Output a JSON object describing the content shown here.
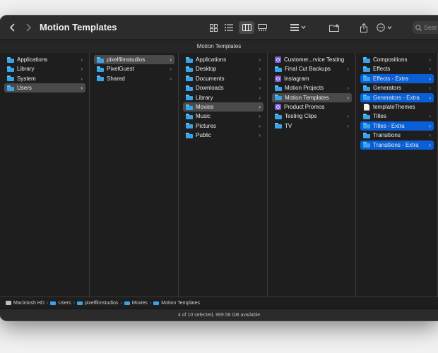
{
  "window": {
    "title": "Motion Templates",
    "tab_title": "Motion Templates",
    "search_placeholder": "Sear"
  },
  "toolbar_icons": [
    "chevron-left-icon",
    "chevron-right-icon",
    "icon-view-icon",
    "list-view-icon",
    "column-view-icon",
    "gallery-view-icon",
    "group-icon",
    "new-folder-icon",
    "share-icon",
    "more-icon",
    "search-icon"
  ],
  "columns": [
    {
      "items": [
        {
          "label": "Applications",
          "icon": "folder",
          "chevron": true,
          "state": ""
        },
        {
          "label": "Library",
          "icon": "folder",
          "chevron": true,
          "state": ""
        },
        {
          "label": "System",
          "icon": "folder",
          "chevron": true,
          "state": ""
        },
        {
          "label": "Users",
          "icon": "folder",
          "chevron": true,
          "state": "gray"
        }
      ]
    },
    {
      "items": [
        {
          "label": "pixelfilmstudios",
          "icon": "folder",
          "chevron": true,
          "state": "gray"
        },
        {
          "label": "PixelGuest",
          "icon": "folder",
          "chevron": true,
          "state": ""
        },
        {
          "label": "Shared",
          "icon": "folder",
          "chevron": true,
          "state": ""
        }
      ]
    },
    {
      "items": [
        {
          "label": "Applications",
          "icon": "folder",
          "chevron": true,
          "state": ""
        },
        {
          "label": "Desktop",
          "icon": "folder",
          "chevron": true,
          "state": ""
        },
        {
          "label": "Documents",
          "icon": "folder",
          "chevron": true,
          "state": ""
        },
        {
          "label": "Downloads",
          "icon": "folder",
          "chevron": true,
          "state": ""
        },
        {
          "label": "Library",
          "icon": "folder",
          "chevron": true,
          "state": ""
        },
        {
          "label": "Movies",
          "icon": "folder",
          "chevron": true,
          "state": "gray"
        },
        {
          "label": "Music",
          "icon": "folder",
          "chevron": true,
          "state": ""
        },
        {
          "label": "Pictures",
          "icon": "folder",
          "chevron": true,
          "state": ""
        },
        {
          "label": "Public",
          "icon": "folder",
          "chevron": true,
          "state": ""
        }
      ]
    },
    {
      "items": [
        {
          "label": "Customer...rvice Testing",
          "icon": "motion",
          "chevron": false,
          "state": ""
        },
        {
          "label": "Final Cut Backups",
          "icon": "folder",
          "chevron": true,
          "state": ""
        },
        {
          "label": "Instagram",
          "icon": "motion",
          "chevron": false,
          "state": ""
        },
        {
          "label": "Motion Projects",
          "icon": "folder",
          "chevron": true,
          "state": ""
        },
        {
          "label": "Motion Templates",
          "icon": "folder",
          "chevron": true,
          "state": "gray"
        },
        {
          "label": "Product Promos",
          "icon": "motion",
          "chevron": false,
          "state": ""
        },
        {
          "label": "Testing Clips",
          "icon": "folder",
          "chevron": true,
          "state": ""
        },
        {
          "label": "TV",
          "icon": "folder",
          "chevron": true,
          "state": ""
        }
      ]
    },
    {
      "items": [
        {
          "label": "Compositions",
          "icon": "folder",
          "chevron": true,
          "state": ""
        },
        {
          "label": "Effects",
          "icon": "folder",
          "chevron": true,
          "state": ""
        },
        {
          "label": "Effects - Extra",
          "icon": "folder",
          "chevron": true,
          "state": "blue"
        },
        {
          "label": "Generators",
          "icon": "folder",
          "chevron": true,
          "state": ""
        },
        {
          "label": "Generators - Extra",
          "icon": "folder",
          "chevron": true,
          "state": "blue"
        },
        {
          "label": "templateThemes",
          "icon": "doc",
          "chevron": false,
          "state": ""
        },
        {
          "label": "Titles",
          "icon": "folder",
          "chevron": true,
          "state": ""
        },
        {
          "label": "Titles - Extra",
          "icon": "folder",
          "chevron": true,
          "state": "blue"
        },
        {
          "label": "Transitions",
          "icon": "folder",
          "chevron": true,
          "state": ""
        },
        {
          "label": "Transitions - Extra",
          "icon": "folder",
          "chevron": true,
          "state": "blue"
        }
      ]
    }
  ],
  "pathbar": [
    {
      "label": "Macintosh HD",
      "icon": "hd"
    },
    {
      "label": "Users",
      "icon": "folder"
    },
    {
      "label": "pixelfilmstudios",
      "icon": "folder"
    },
    {
      "label": "Movies",
      "icon": "folder"
    },
    {
      "label": "Motion Templates",
      "icon": "folder"
    }
  ],
  "status": "4 of 10 selected, 969.58 GB available",
  "colors": {
    "selection_blue": "#0a5fd6",
    "selection_gray": "#4a4a4a",
    "folder_blue": "#3aa3e8"
  }
}
